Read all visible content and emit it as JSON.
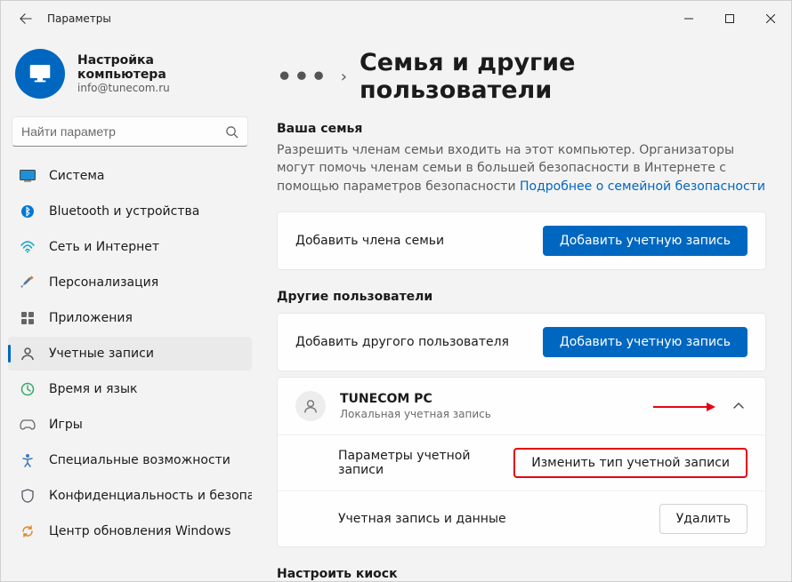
{
  "window": {
    "title": "Параметры"
  },
  "profile": {
    "name": "Настройка компьютера",
    "email": "info@tunecom.ru"
  },
  "search": {
    "placeholder": "Найти параметр"
  },
  "nav": {
    "system": "Система",
    "bluetooth": "Bluetooth и устройства",
    "network": "Сеть и Интернет",
    "personalization": "Персонализация",
    "apps": "Приложения",
    "accounts": "Учетные записи",
    "time": "Время и язык",
    "gaming": "Игры",
    "accessibility": "Специальные возможности",
    "privacy": "Конфиденциальность и безопасность",
    "update": "Центр обновления Windows"
  },
  "main": {
    "breadcrumb_title": "Семья и другие пользователи",
    "family_head": "Ваша семья",
    "family_desc": "Разрешить членам семьи входить на этот компьютер. Организаторы могут помочь членам семьи в большей безопасности в Интернете с помощью параметров безопасности ",
    "family_link": "Подробнее о семейной безопасности",
    "add_family_label": "Добавить члена семьи",
    "add_account_btn": "Добавить учетную запись",
    "others_head": "Другие пользователи",
    "add_other_label": "Добавить другого пользователя",
    "user": {
      "name": "TUNECOM PC",
      "type": "Локальная учетная запись"
    },
    "account_params_label": "Параметры учетной записи",
    "change_type_btn": "Изменить тип учетной записи",
    "account_data_label": "Учетная запись и данные",
    "delete_btn": "Удалить",
    "kiosk_head": "Настроить киоск"
  }
}
